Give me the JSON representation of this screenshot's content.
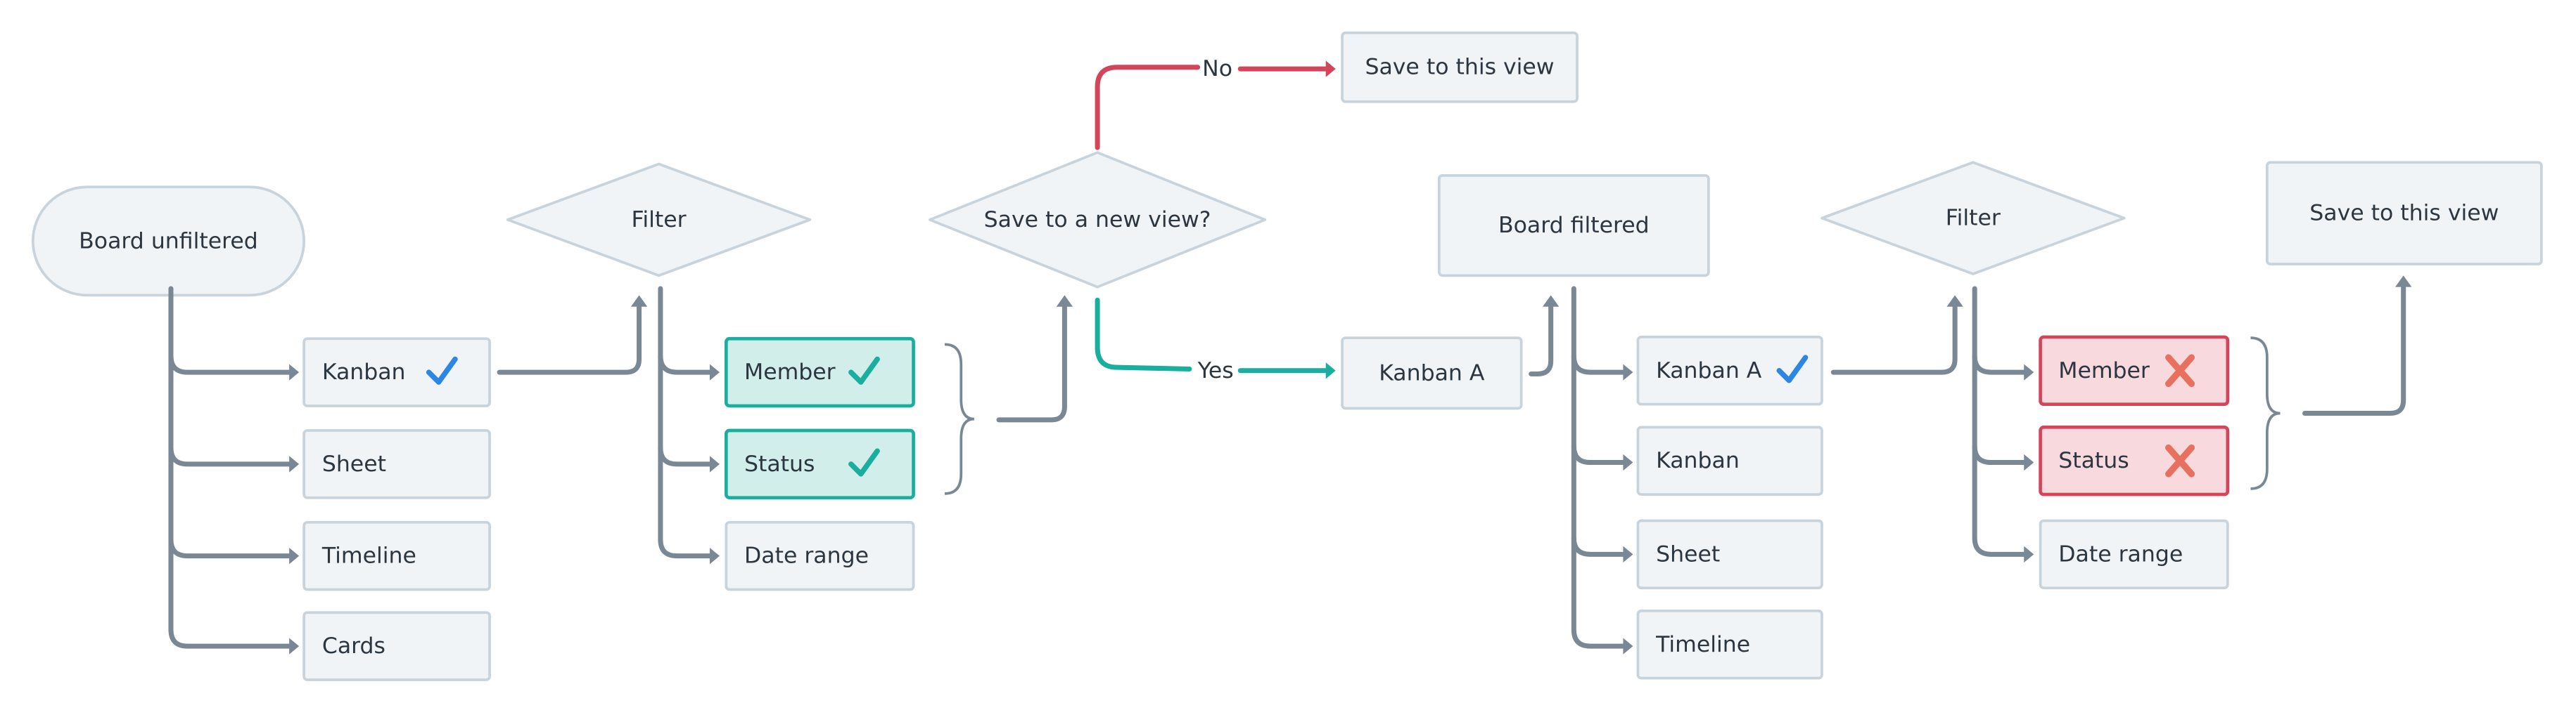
{
  "colors": {
    "node_fill": "#f0f4f7",
    "node_stroke": "#c8d3dc",
    "text": "#2b3640",
    "connector": "#7a8896",
    "yes": "#1aae9f",
    "selected_fill": "#d2eeeb",
    "no": "#d3455b",
    "rejected_fill": "#f7d9de",
    "cross": "#e8705f",
    "check_blue": "#2d87e2"
  },
  "nodes": {
    "board_unfiltered": "Board unfiltered",
    "views_1": [
      {
        "label": "Kanban",
        "icon": "check-icon-blue"
      },
      {
        "label": "Sheet"
      },
      {
        "label": "Timeline"
      },
      {
        "label": "Cards"
      }
    ],
    "filter_1": "Filter",
    "filters_1": [
      {
        "label": "Member",
        "icon": "check-icon-teal",
        "state": "selected"
      },
      {
        "label": "Status",
        "icon": "check-icon-teal",
        "state": "selected"
      },
      {
        "label": "Date range"
      }
    ],
    "decision": "Save to a new view?",
    "no_label": "No",
    "yes_label": "Yes",
    "save_this_view_1": "Save to this view",
    "kanban_a": "Kanban A",
    "board_filtered": "Board filtered",
    "views_2": [
      {
        "label": "Kanban A",
        "icon": "check-icon-blue"
      },
      {
        "label": "Kanban"
      },
      {
        "label": "Sheet"
      },
      {
        "label": "Timeline"
      }
    ],
    "filter_2": "Filter",
    "filters_2": [
      {
        "label": "Member",
        "icon": "cross-icon",
        "state": "rejected"
      },
      {
        "label": "Status",
        "icon": "cross-icon",
        "state": "rejected"
      },
      {
        "label": "Date range"
      }
    ],
    "save_this_view_2": "Save to this view"
  }
}
